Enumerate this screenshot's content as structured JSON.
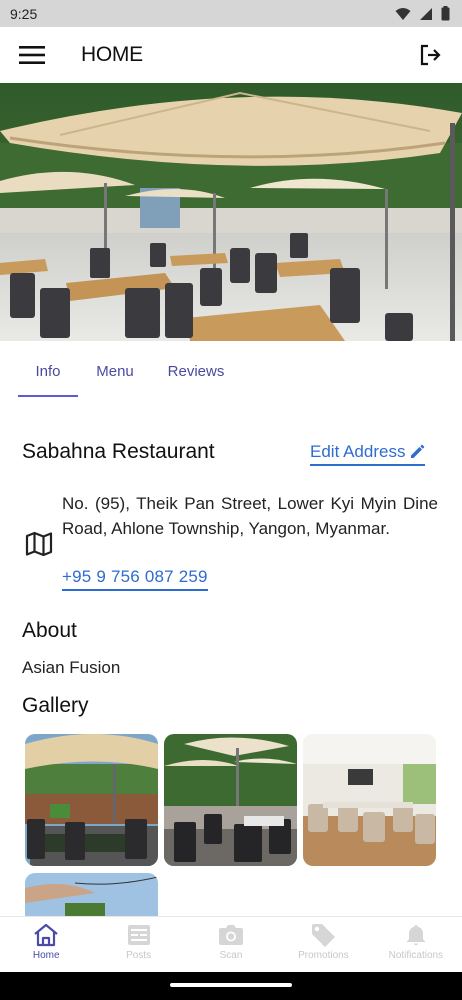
{
  "status_bar": {
    "time": "9:25"
  },
  "app_bar": {
    "title": "HOME",
    "menu_icon": "hamburger-icon",
    "logout_icon": "logout-icon"
  },
  "tabs": [
    {
      "label": "Info",
      "active": true
    },
    {
      "label": "Menu",
      "active": false
    },
    {
      "label": "Reviews",
      "active": false
    }
  ],
  "restaurant": {
    "name": "Sabahna Restaurant",
    "edit_address_label": "Edit Address",
    "address": "No. (95), Theik Pan Street, Lower Kyi Myin Dine Road, Ahlone Township, Yangon, Myanmar.",
    "phone": "+95 9 756 087 259"
  },
  "about": {
    "heading": "About",
    "text": "Asian Fusion"
  },
  "gallery": {
    "heading": "Gallery"
  },
  "bottom_nav": [
    {
      "label": "Home",
      "icon": "home-icon",
      "active": true
    },
    {
      "label": "Posts",
      "icon": "posts-icon",
      "active": false
    },
    {
      "label": "Scan",
      "icon": "camera-icon",
      "active": false
    },
    {
      "label": "Promotions",
      "icon": "tag-icon",
      "active": false
    },
    {
      "label": "Notifications",
      "icon": "bell-icon",
      "active": false
    }
  ],
  "colors": {
    "accent": "#2f6ccf",
    "tab": "#4a4aa0",
    "nav_active": "#4b4ba8",
    "nav_inactive": "#c7c7c7"
  }
}
